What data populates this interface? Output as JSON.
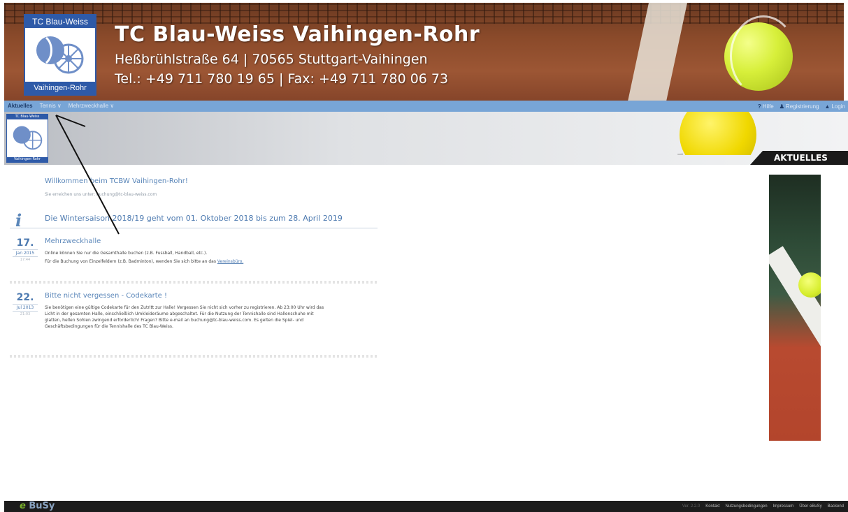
{
  "header": {
    "logo_top": "TC Blau-Weiss",
    "logo_bottom": "Vaihingen-Rohr",
    "title": "TC Blau-Weiss Vaihingen-Rohr",
    "address": "Heßbrühlstraße 64  |  70565 Stuttgart-Vaihingen",
    "contact": "Tel.: +49 711 780 19 65 | Fax: +49 711 780 06 73"
  },
  "nav": {
    "items": [
      {
        "label": "Aktuelles",
        "active": true
      },
      {
        "label": "Tennis ∨",
        "active": false
      },
      {
        "label": "Mehrzweckhalle ∨",
        "active": false
      }
    ],
    "right": {
      "help": "Hilfe",
      "register": "Registrierung",
      "login": "Login"
    }
  },
  "subheader": {
    "logo_top": "TC Blau-Weiss",
    "logo_bottom": "Vaihingen-Rohr",
    "tab_label": "AKTUELLES"
  },
  "welcome": {
    "title": "Willkommen beim TCBW Vaihingen-Rohr!",
    "sub": "Sie erreichen uns unter: buchung@tc-blau-weiss.com"
  },
  "season": {
    "text": "Die Wintersaison 2018/19 geht vom 01. Oktober 2018 bis zum 28. April 2019"
  },
  "entries": [
    {
      "day": "17.",
      "month": "Jan 2015",
      "time": "17:44",
      "title": "Mehrzweckhalle",
      "p1": "Online können Sie nur die Gesamthalle buchen (z.B. Fussball, Handball, etc.).",
      "p2": "Für die Buchung von Einzelfeldern (z.B. Badminton), wenden Sie sich bitte an das",
      "p2_link": "Vereinsbüro."
    },
    {
      "day": "22.",
      "month": "Jul 2013",
      "time": "21:03",
      "title": "Bitte nicht vergessen - Codekarte !",
      "p1": "Sie benötigen eine gültige Codekarte für den Zutritt zur Halle! Vergessen Sie nicht sich vorher zu registrieren. Ab 23:00 Uhr wird das Licht in der gesamten Halle, einschließlich Umkleideräume abgeschaltet. Für die Nutzung der Tennishalle sind Hallenschuhe mit glatten, hellen Sohlen zwingend erforderlich! Fragen? Bitte e-mail an buchung@tc-blau-weiss.com. Es gelten die Spiel- und Geschäftsbedingungen für die Tennishalle des TC Blau-Weiss."
    }
  ],
  "footer": {
    "brand_e": "e",
    "brand_rest": "BuSy",
    "version": "Ver. 2.2.0",
    "links": [
      "Kontakt",
      "Nutzungsbedingungen",
      "Impressum",
      "Über eBuSy",
      "Backend"
    ]
  },
  "colors": {
    "nav": "#78a5d6",
    "accent": "#4d7ab0",
    "footer": "#1c1c1c"
  }
}
